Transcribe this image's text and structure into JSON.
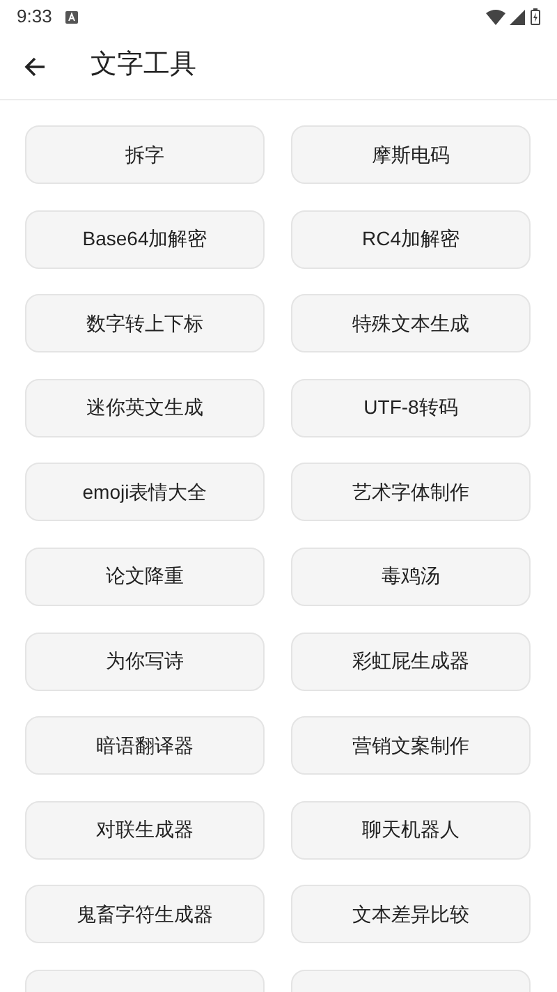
{
  "status_bar": {
    "time": "9:33"
  },
  "app_bar": {
    "title": "文字工具"
  },
  "tools": [
    {
      "label": "拆字"
    },
    {
      "label": "摩斯电码"
    },
    {
      "label": "Base64加解密"
    },
    {
      "label": "RC4加解密"
    },
    {
      "label": "数字转上下标"
    },
    {
      "label": "特殊文本生成"
    },
    {
      "label": "迷你英文生成"
    },
    {
      "label": "UTF-8转码"
    },
    {
      "label": "emoji表情大全"
    },
    {
      "label": "艺术字体制作"
    },
    {
      "label": "论文降重"
    },
    {
      "label": "毒鸡汤"
    },
    {
      "label": "为你写诗"
    },
    {
      "label": "彩虹屁生成器"
    },
    {
      "label": "暗语翻译器"
    },
    {
      "label": "营销文案制作"
    },
    {
      "label": "对联生成器"
    },
    {
      "label": "聊天机器人"
    },
    {
      "label": "鬼畜字符生成器"
    },
    {
      "label": "文本差异比较"
    }
  ],
  "more_below": true
}
